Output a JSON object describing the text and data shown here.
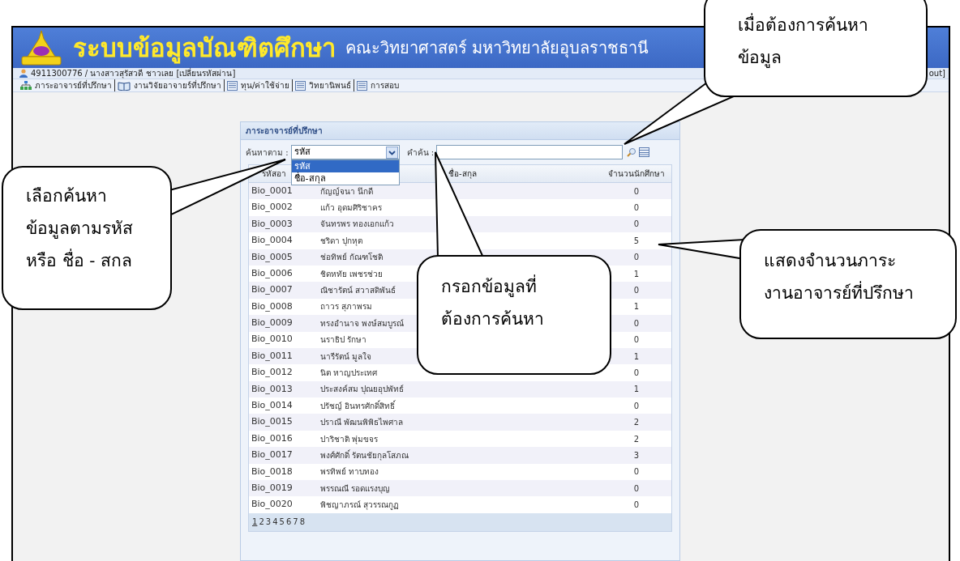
{
  "header": {
    "title": "ระบบข้อมูลบัณฑิตศึกษา",
    "subtitle": "คณะวิทยาศาสตร์ มหาวิทยาลัยอุบลราชธานี"
  },
  "user_bar": {
    "user": "4911300776 / นางสาวสุรัสวดี ชาวเลย",
    "change_password": "[เปลี่ยนรหัสผ่าน]",
    "logout": "out]"
  },
  "menu": [
    {
      "label": "ภาระอาจารย์ที่ปรึกษา",
      "kind": "tree"
    },
    {
      "label": "งานวิจัยอาจายร์ที่ปรึกษา",
      "kind": "book"
    },
    {
      "label": "ทุน/ค่าใช้จ่าย",
      "kind": "list"
    },
    {
      "label": "วิทยานิพนธ์",
      "kind": "list"
    },
    {
      "label": "การสอบ",
      "kind": "list"
    }
  ],
  "panel": {
    "title": "ภาระอาจารย์ที่ปรึกษา",
    "search": {
      "label": "ค้นหาตาม :",
      "value": "รหัส",
      "options": [
        {
          "label": "รหัส",
          "selected": true
        },
        {
          "label": "ชื่อ-สกุล",
          "selected": false
        }
      ],
      "keyword_label": "คำค้น :"
    },
    "table": {
      "columns": [
        "รหัสอา",
        "ชื่อ-สกุล",
        "จำนวนนักศึกษา"
      ],
      "rows": [
        [
          "Bio_0001",
          "กัญญ์จนา นึกดี",
          "0"
        ],
        [
          "Bio_0002",
          "แก้ว อุดมศิริชาคร",
          "0"
        ],
        [
          "Bio_0003",
          "จันทรพร ทองเอกแก้ว",
          "0"
        ],
        [
          "Bio_0004",
          "ชริดา ปุกหุต",
          "5"
        ],
        [
          "Bio_0005",
          "ช่อทิพย์ กัณฑโชติ",
          "0"
        ],
        [
          "Bio_0006",
          "ชิดหทัย เพชรช่วย",
          "1"
        ],
        [
          "Bio_0007",
          "ณิชารัตน์ สวาสดิพันธ์",
          "0"
        ],
        [
          "Bio_0008",
          "ถาวร สุภาพรม",
          "1"
        ],
        [
          "Bio_0009",
          "ทรงอำนาจ พงษ์สมบูรณ์",
          "0"
        ],
        [
          "Bio_0010",
          "นราธิป รักษา",
          "0"
        ],
        [
          "Bio_0011",
          "นารีรัตน์ มูลใจ",
          "1"
        ],
        [
          "Bio_0012",
          "นิต หาญประเทศ",
          "0"
        ],
        [
          "Bio_0013",
          "ประสงค์สม ปุณยอุปพัทธ์",
          "1"
        ],
        [
          "Bio_0014",
          "ปรัชญ์ อินทรศักดิ์สิทธิ์",
          "0"
        ],
        [
          "Bio_0015",
          "ปราณี พัฒนพิพิธไพศาล",
          "2"
        ],
        [
          "Bio_0016",
          "ปาริชาติ พุ่มขจร",
          "2"
        ],
        [
          "Bio_0017",
          "พงศ์ศักดิ์ รัตนชัยกุลโสภณ",
          "3"
        ],
        [
          "Bio_0018",
          "พรทิพย์ ทาบทอง",
          "0"
        ],
        [
          "Bio_0019",
          "พรรณณี รอดแรงบุญ",
          "0"
        ],
        [
          "Bio_0020",
          "พิชญาภรณ์ สุวรรณกูฏ",
          "0"
        ]
      ]
    },
    "pages": [
      {
        "label": "1",
        "selected": true
      },
      {
        "label": "2",
        "selected": false
      },
      {
        "label": "3",
        "selected": false
      },
      {
        "label": "4",
        "selected": false
      },
      {
        "label": "5",
        "selected": false
      },
      {
        "label": "6",
        "selected": false
      },
      {
        "label": "7",
        "selected": false
      },
      {
        "label": "8",
        "selected": false
      }
    ]
  },
  "callouts": [
    {
      "lines": [
        "เมื่อต้องการค้นหา",
        "ข้อมูล"
      ]
    },
    {
      "lines": [
        "เลือกค้นหา",
        "ข้อมูลตามรหัส",
        "หรือ ชื่อ - สกล"
      ]
    },
    {
      "lines": [
        "กรอกข้อมูลที่",
        "ต้องการค้นหา"
      ]
    },
    {
      "lines": [
        "แสดงจำนวนภาระ",
        "งานอาจารย์ที่ปรึกษา"
      ]
    }
  ]
}
